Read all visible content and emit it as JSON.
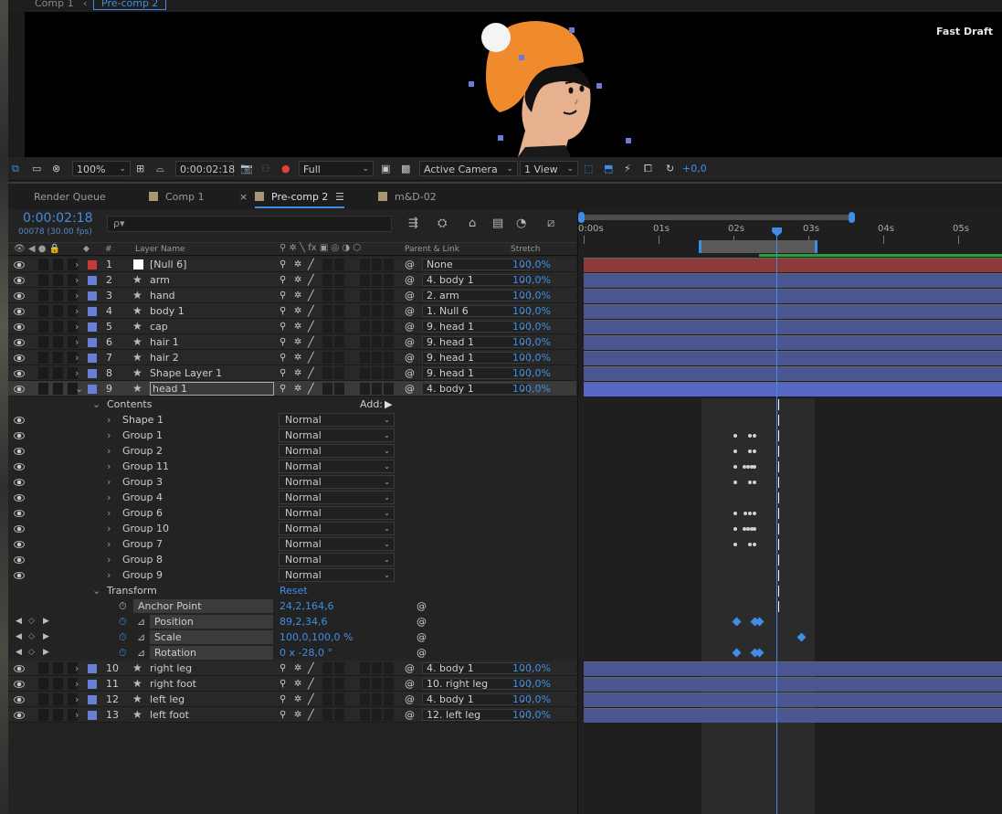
{
  "breadcrumbs": {
    "items": [
      "Comp 1",
      "Pre-comp 2"
    ]
  },
  "viewer": {
    "overlay_text": "Fast Draft"
  },
  "viewer_toolbar": {
    "zoom": "100%",
    "timecode": "0:00:02:18",
    "resolution": "Full",
    "camera": "Active Camera",
    "views": "1 View",
    "exposure": "+0,0"
  },
  "tabs": [
    {
      "label": "Render Queue",
      "close": ""
    },
    {
      "label": "Comp 1",
      "close": ""
    },
    {
      "label": "Pre-comp 2",
      "close": "×",
      "menu": "☰"
    },
    {
      "label": "m&D-02",
      "close": ""
    }
  ],
  "timeline": {
    "timecode": "0:00:02:18",
    "frame_info": "00078 (30.00 fps)",
    "search_placeholder": "ρ▾",
    "ruler": [
      "0:00s",
      "01s",
      "02s",
      "03s",
      "04s",
      "05s"
    ],
    "playhead_seconds": 2.6,
    "col_headers": {
      "num": "#",
      "name": "Layer Name",
      "parent": "Parent & Link",
      "stretch": "Stretch"
    }
  },
  "layers_top": [
    {
      "num": "1",
      "name": "[Null 6]",
      "color": "#c23a3a",
      "star": false,
      "parent": "None",
      "stretch": "100,0%"
    },
    {
      "num": "2",
      "name": "arm",
      "color": "#6a7ed6",
      "star": true,
      "parent": "4. body 1",
      "stretch": "100,0%"
    },
    {
      "num": "3",
      "name": "hand",
      "color": "#6a7ed6",
      "star": true,
      "parent": "2. arm",
      "stretch": "100,0%"
    },
    {
      "num": "4",
      "name": "body 1",
      "color": "#6a7ed6",
      "star": true,
      "parent": "1. Null 6",
      "stretch": "100,0%"
    },
    {
      "num": "5",
      "name": "cap",
      "color": "#6a7ed6",
      "star": true,
      "parent": "9. head 1",
      "stretch": "100,0%"
    },
    {
      "num": "6",
      "name": "hair 1",
      "color": "#6a7ed6",
      "star": true,
      "parent": "9. head 1",
      "stretch": "100,0%"
    },
    {
      "num": "7",
      "name": "hair 2",
      "color": "#6a7ed6",
      "star": true,
      "parent": "9. head 1",
      "stretch": "100,0%"
    },
    {
      "num": "8",
      "name": "Shape Layer 1",
      "color": "#6a7ed6",
      "star": true,
      "parent": "9. head 1",
      "stretch": "100,0%"
    },
    {
      "num": "9",
      "name": "head 1",
      "color": "#6a7ed6",
      "star": true,
      "parent": "4. body 1",
      "stretch": "100,0%"
    }
  ],
  "contents": {
    "label": "Contents",
    "add_label": "Add:",
    "groups": [
      {
        "name": "Shape 1",
        "mode": "Normal"
      },
      {
        "name": "Group 1",
        "mode": "Normal"
      },
      {
        "name": "Group 2",
        "mode": "Normal"
      },
      {
        "name": "Group 11",
        "mode": "Normal"
      },
      {
        "name": "Group 3",
        "mode": "Normal"
      },
      {
        "name": "Group 4",
        "mode": "Normal"
      },
      {
        "name": "Group 6",
        "mode": "Normal"
      },
      {
        "name": "Group 10",
        "mode": "Normal"
      },
      {
        "name": "Group 7",
        "mode": "Normal"
      },
      {
        "name": "Group 8",
        "mode": "Normal"
      },
      {
        "name": "Group 9",
        "mode": "Normal"
      }
    ]
  },
  "transform": {
    "label": "Transform",
    "reset": "Reset",
    "props": [
      {
        "name": "Anchor Point",
        "value": "24,2,164,6"
      },
      {
        "name": "Position",
        "value": "89,2,34,6"
      },
      {
        "name": "Scale",
        "value": "100,0,100,0 %"
      },
      {
        "name": "Rotation",
        "value": "0 x -28,0 °"
      }
    ]
  },
  "layers_bottom": [
    {
      "num": "10",
      "name": "right leg",
      "parent": "4. body 1",
      "stretch": "100,0%"
    },
    {
      "num": "11",
      "name": "right foot",
      "parent": "10. right leg",
      "stretch": "100,0%"
    },
    {
      "num": "12",
      "name": "left leg",
      "parent": "4. body 1",
      "stretch": "100,0%"
    },
    {
      "num": "13",
      "name": "left foot",
      "parent": "12. left leg",
      "stretch": "100,0%"
    }
  ],
  "colors": {
    "accent": "#3f8ee5",
    "null_bar": "#8c3a3a",
    "layer_bar": "#4a5591",
    "label_blue": "#6a7ed6",
    "label_red": "#c23a3a"
  }
}
